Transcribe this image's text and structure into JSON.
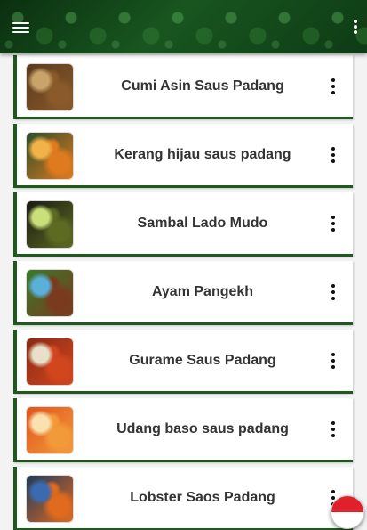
{
  "app_bar": {
    "menu_icon": "hamburger-menu-icon",
    "overflow_icon": "more-vertical-icon",
    "color": "#0d3a14"
  },
  "recipes": [
    {
      "title": "Cumi Asin Saus Padang",
      "thumb_colors": [
        "#5a3a1e",
        "#8a5a2a",
        "#c9a46a"
      ]
    },
    {
      "title": "Kerang hijau saus padang",
      "thumb_colors": [
        "#2b4d2a",
        "#e07a1e",
        "#f2b24a"
      ]
    },
    {
      "title": "Sambal Lado Mudo",
      "thumb_colors": [
        "#1a1a12",
        "#5c6a22",
        "#c9e07a"
      ]
    },
    {
      "title": "Ayam Pangekh",
      "thumb_colors": [
        "#3a7a2a",
        "#7a3a1e",
        "#5ab0d8"
      ]
    },
    {
      "title": "Gurame Saus Padang",
      "thumb_colors": [
        "#8a2a14",
        "#d2461e",
        "#e8e0c8"
      ]
    },
    {
      "title": "Udang baso saus padang",
      "thumb_colors": [
        "#e0541e",
        "#f29a3a",
        "#fae2b0"
      ]
    },
    {
      "title": "Lobster Saos Padang",
      "thumb_colors": [
        "#1e3a5a",
        "#e06a1e",
        "#3a6ab0"
      ]
    }
  ],
  "card_accent": "#1f5a1d",
  "language_button": {
    "icon": "indonesia-flag-icon",
    "colors": [
      "#e0202a",
      "#ffffff"
    ]
  }
}
